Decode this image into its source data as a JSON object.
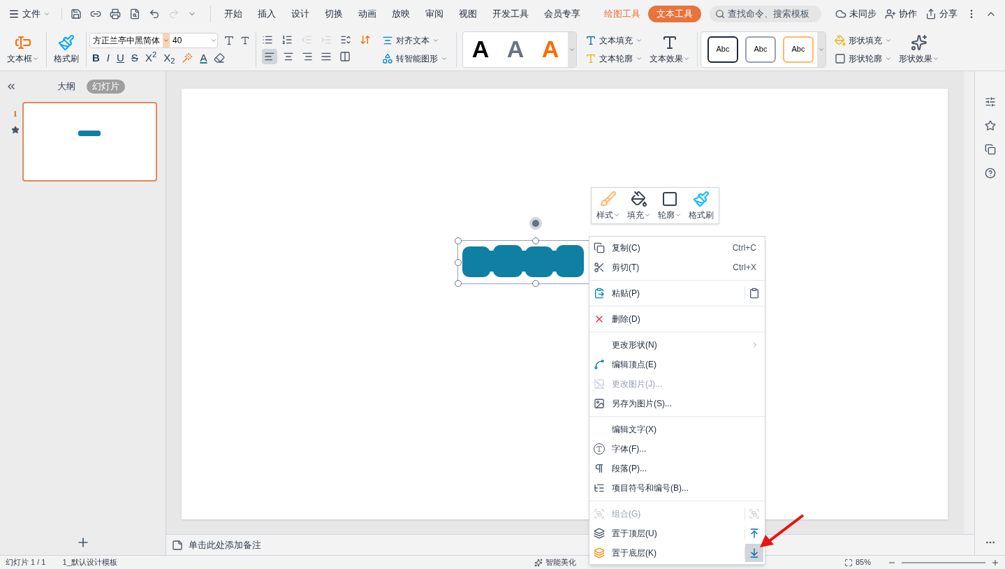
{
  "menu_bar": {
    "file": "文件",
    "tabs": [
      {
        "label": "开始",
        "selected": false,
        "kind": "main"
      },
      {
        "label": "插入",
        "selected": false,
        "kind": "main"
      },
      {
        "label": "设计",
        "selected": false,
        "kind": "main"
      },
      {
        "label": "切换",
        "selected": false,
        "kind": "main"
      },
      {
        "label": "动画",
        "selected": false,
        "kind": "main"
      },
      {
        "label": "放映",
        "selected": false,
        "kind": "main"
      },
      {
        "label": "审阅",
        "selected": false,
        "kind": "main"
      },
      {
        "label": "视图",
        "selected": false,
        "kind": "main"
      },
      {
        "label": "开发工具",
        "selected": false,
        "kind": "main"
      },
      {
        "label": "会员专享",
        "selected": false,
        "kind": "main"
      },
      {
        "label": "绘图工具",
        "selected": false,
        "kind": "context"
      },
      {
        "label": "文本工具",
        "selected": true,
        "kind": "context"
      }
    ],
    "search": {
      "placeholder": "查找命令、搜索模板"
    },
    "actions": [
      "未同步",
      "协作",
      "分享"
    ]
  },
  "ribbon": {
    "textbox": "文本框",
    "format_painter": "格式刷",
    "font": {
      "name": "方正兰亭中黑简体",
      "size": "40"
    },
    "format_buttons": [
      "B",
      "I",
      "U",
      "S",
      "X$^{2}$",
      "X$_{2}$"
    ],
    "font_color": "A",
    "align_buttons": [
      {
        "selected": true
      },
      {
        "selected": false
      },
      {
        "selected": false
      },
      {
        "selected": false
      },
      {
        "selected": false
      }
    ],
    "align_text": "对齐文本",
    "smart_shape": "转智能图形",
    "text_styles": [
      "A",
      "A",
      "A"
    ],
    "text_fill": "文本填充",
    "text_outline": "文本轮廓",
    "text_effect": "文本效果",
    "shape_styles": [
      "Abc",
      "Abc",
      "Abc"
    ],
    "shape_fill": "形状填充",
    "shape_outline": "形状轮廓",
    "shape_effect": "形状效果"
  },
  "left_pane": {
    "tabs": [
      {
        "label": "大纲",
        "selected": false
      },
      {
        "label": "幻灯片",
        "selected": true
      }
    ],
    "slides": [
      {
        "number": "1",
        "selected": true
      }
    ]
  },
  "mini_toolbar": [
    {
      "label": "样式",
      "dropdown": true
    },
    {
      "label": "填充",
      "dropdown": true
    },
    {
      "label": "轮廓",
      "dropdown": true
    },
    {
      "label": "格式刷",
      "dropdown": false
    }
  ],
  "context_menu": [
    {
      "kind": "item",
      "label": "复制(C)",
      "shortcut": "Ctrl+C",
      "disabled": false
    },
    {
      "kind": "item",
      "label": "剪切(T)",
      "shortcut": "Ctrl+X",
      "disabled": false
    },
    {
      "kind": "separator"
    },
    {
      "kind": "split",
      "label": "粘贴(P)",
      "disabled": false,
      "side_selected": false
    },
    {
      "kind": "separator"
    },
    {
      "kind": "item",
      "label": "删除(D)",
      "disabled": false
    },
    {
      "kind": "separator"
    },
    {
      "kind": "submenu",
      "label": "更改形状(N)",
      "disabled": false
    },
    {
      "kind": "item",
      "label": "编辑顶点(E)",
      "disabled": false
    },
    {
      "kind": "item",
      "label": "更改图片(J)...",
      "disabled": true
    },
    {
      "kind": "item",
      "label": "另存为图片(S)...",
      "disabled": false
    },
    {
      "kind": "separator"
    },
    {
      "kind": "item",
      "label": "编辑文字(X)",
      "disabled": false
    },
    {
      "kind": "item",
      "label": "字体(F)...",
      "disabled": false
    },
    {
      "kind": "item",
      "label": "段落(P)...",
      "disabled": false
    },
    {
      "kind": "item",
      "label": "项目符号和编号(B)...",
      "disabled": false
    },
    {
      "kind": "separator"
    },
    {
      "kind": "split",
      "label": "组合(G)",
      "disabled": true,
      "side_selected": false
    },
    {
      "kind": "split",
      "label": "置于顶层(U)",
      "disabled": false,
      "side_selected": false
    },
    {
      "kind": "split",
      "label": "置于底层(K)",
      "disabled": false,
      "side_selected": true
    }
  ],
  "notes": {
    "placeholder": "单击此处添加备注"
  },
  "status_bar": {
    "slide": "幻灯片 1 / 1",
    "template": "1_默认设计模板",
    "beautify": "智能美化",
    "zoom": "85%"
  }
}
